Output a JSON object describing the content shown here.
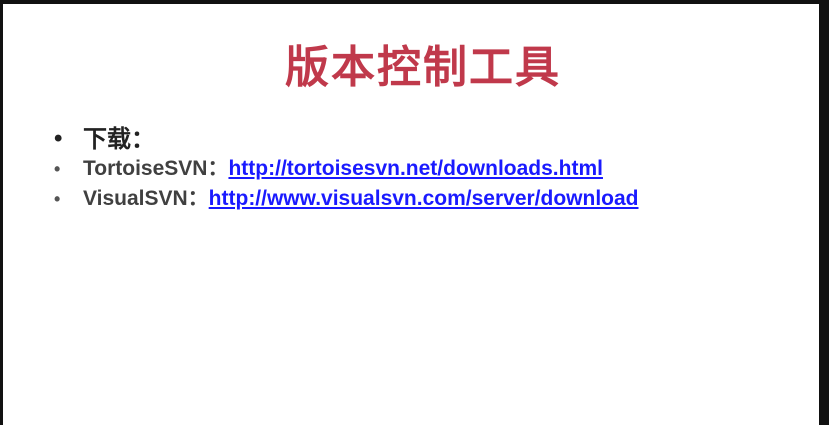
{
  "slide": {
    "title": "版本控制工具",
    "bullets": [
      {
        "label": "下载："
      },
      {
        "label": "TortoiseSVN：",
        "link": "http://tortoisesvn.net/downloads.html"
      },
      {
        "label": "VisualSVN：",
        "link": "http://www.visualsvn.com/server/download"
      }
    ]
  },
  "colors": {
    "title": "#c0394b",
    "link": "#1a1aff",
    "text": "#404040",
    "background": "#ffffff"
  }
}
